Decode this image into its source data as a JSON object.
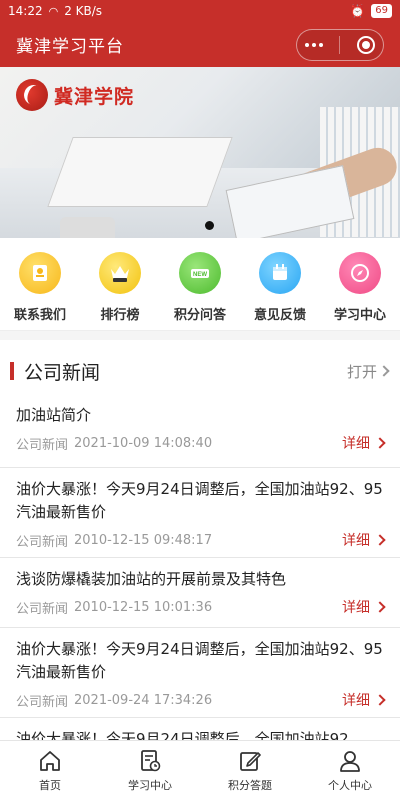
{
  "status_bar": {
    "time": "14:22",
    "speed": "2 KB/s",
    "battery": "69"
  },
  "nav": {
    "title": "冀津学习平台"
  },
  "banner": {
    "logo_text": "冀津学院"
  },
  "quick_menu": [
    {
      "label": "联系我们",
      "icon": "contact-icon"
    },
    {
      "label": "排行榜",
      "icon": "crown-vip-icon"
    },
    {
      "label": "积分问答",
      "icon": "new-badge-icon"
    },
    {
      "label": "意见反馈",
      "icon": "calendar-icon"
    },
    {
      "label": "学习中心",
      "icon": "compass-icon"
    }
  ],
  "news": {
    "section_title": "公司新闻",
    "open_label": "打开",
    "detail_label": "详细",
    "items": [
      {
        "title": "加油站简介",
        "category": "公司新闻",
        "time": "2021-10-09 14:08:40"
      },
      {
        "title": "油价大暴涨！今天9月24日调整后，全国加油站92、95汽油最新售价",
        "category": "公司新闻",
        "time": "2010-12-15 09:48:17"
      },
      {
        "title": "浅谈防爆橇装加油站的开展前景及其特色",
        "category": "公司新闻",
        "time": "2010-12-15 10:01:36"
      },
      {
        "title": "油价大暴涨！今天9月24日调整后，全国加油站92、95汽油最新售价",
        "category": "公司新闻",
        "time": "2021-09-24 17:34:26"
      },
      {
        "title": "油价大暴涨！今天9月24日调整后，全国加油站92",
        "category": "",
        "time": ""
      }
    ]
  },
  "tabbar": [
    {
      "label": "首页",
      "icon": "home-icon"
    },
    {
      "label": "学习中心",
      "icon": "study-record-icon"
    },
    {
      "label": "积分答题",
      "icon": "edit-icon"
    },
    {
      "label": "个人中心",
      "icon": "user-icon"
    }
  ],
  "colors": {
    "brand_red": "#c62f2a"
  }
}
